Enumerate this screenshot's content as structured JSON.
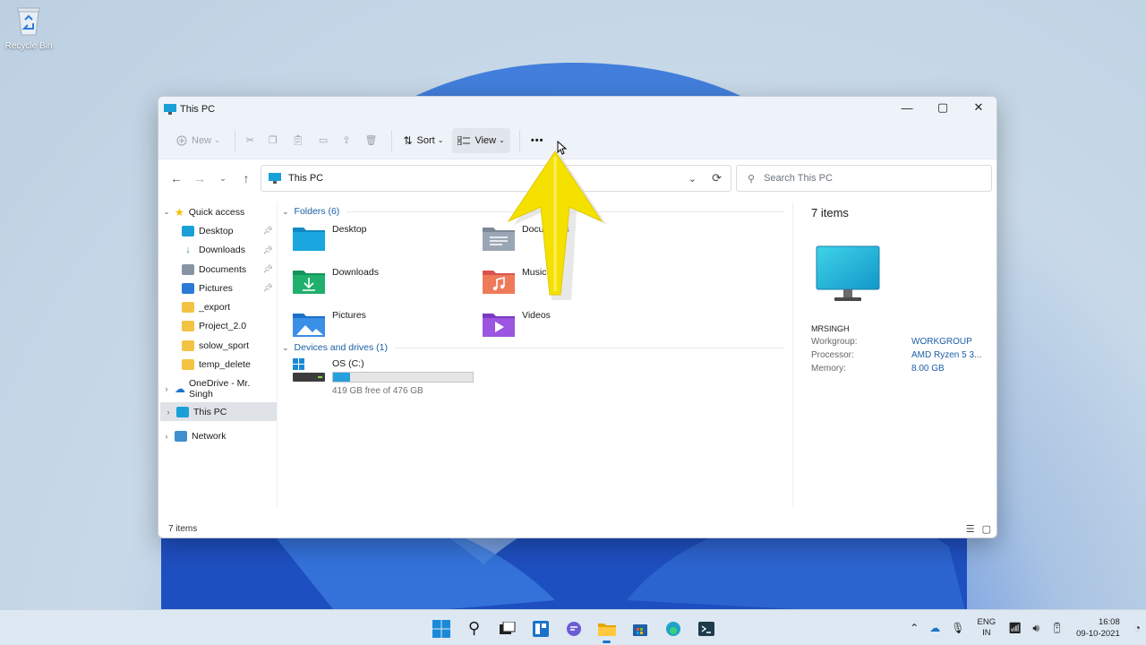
{
  "desktop": {
    "recycle_bin_label": "Recycle Bin"
  },
  "window": {
    "title": "This PC",
    "controls": {
      "minimize": "—",
      "maximize": "▢",
      "close": "✕"
    }
  },
  "command_bar": {
    "new_label": "New",
    "sort_label": "Sort",
    "view_label": "View",
    "more_label": "•••"
  },
  "address_bar": {
    "path": "This PC",
    "search_placeholder": "Search This PC"
  },
  "nav_pane": {
    "quick_access": "Quick access",
    "quick_items": [
      {
        "label": "Desktop",
        "pinned": true
      },
      {
        "label": "Downloads",
        "pinned": true
      },
      {
        "label": "Documents",
        "pinned": true
      },
      {
        "label": "Pictures",
        "pinned": true
      },
      {
        "label": "_export",
        "pinned": false
      },
      {
        "label": "Project_2.0",
        "pinned": false
      },
      {
        "label": "solow_sport",
        "pinned": false
      },
      {
        "label": "temp_delete",
        "pinned": false
      }
    ],
    "onedrive": "OneDrive - Mr. Singh",
    "this_pc": "This PC",
    "network": "Network"
  },
  "content": {
    "folders_header": "Folders (6)",
    "folders": [
      "Desktop",
      "Documents",
      "Downloads",
      "Music",
      "Pictures",
      "Videos"
    ],
    "devices_header": "Devices and drives (1)",
    "drive": {
      "name": "OS (C:)",
      "free_text": "419 GB free of 476 GB",
      "used_fraction": 0.12
    }
  },
  "details": {
    "count": "7 items",
    "computer_name": "MRSINGH",
    "props": [
      {
        "key": "Workgroup:",
        "value": "WORKGROUP"
      },
      {
        "key": "Processor:",
        "value": "AMD Ryzen 5 3..."
      },
      {
        "key": "Memory:",
        "value": "8.00 GB"
      }
    ]
  },
  "status": {
    "items": "7 items"
  },
  "taskbar": {
    "lang_top": "ENG",
    "lang_bottom": "IN",
    "time": "16:08",
    "date": "09-10-2021"
  },
  "colors": {
    "accent": "#1a73c8",
    "folder_blue": "#1aa0d8",
    "annotation_yellow": "#f5e100"
  }
}
